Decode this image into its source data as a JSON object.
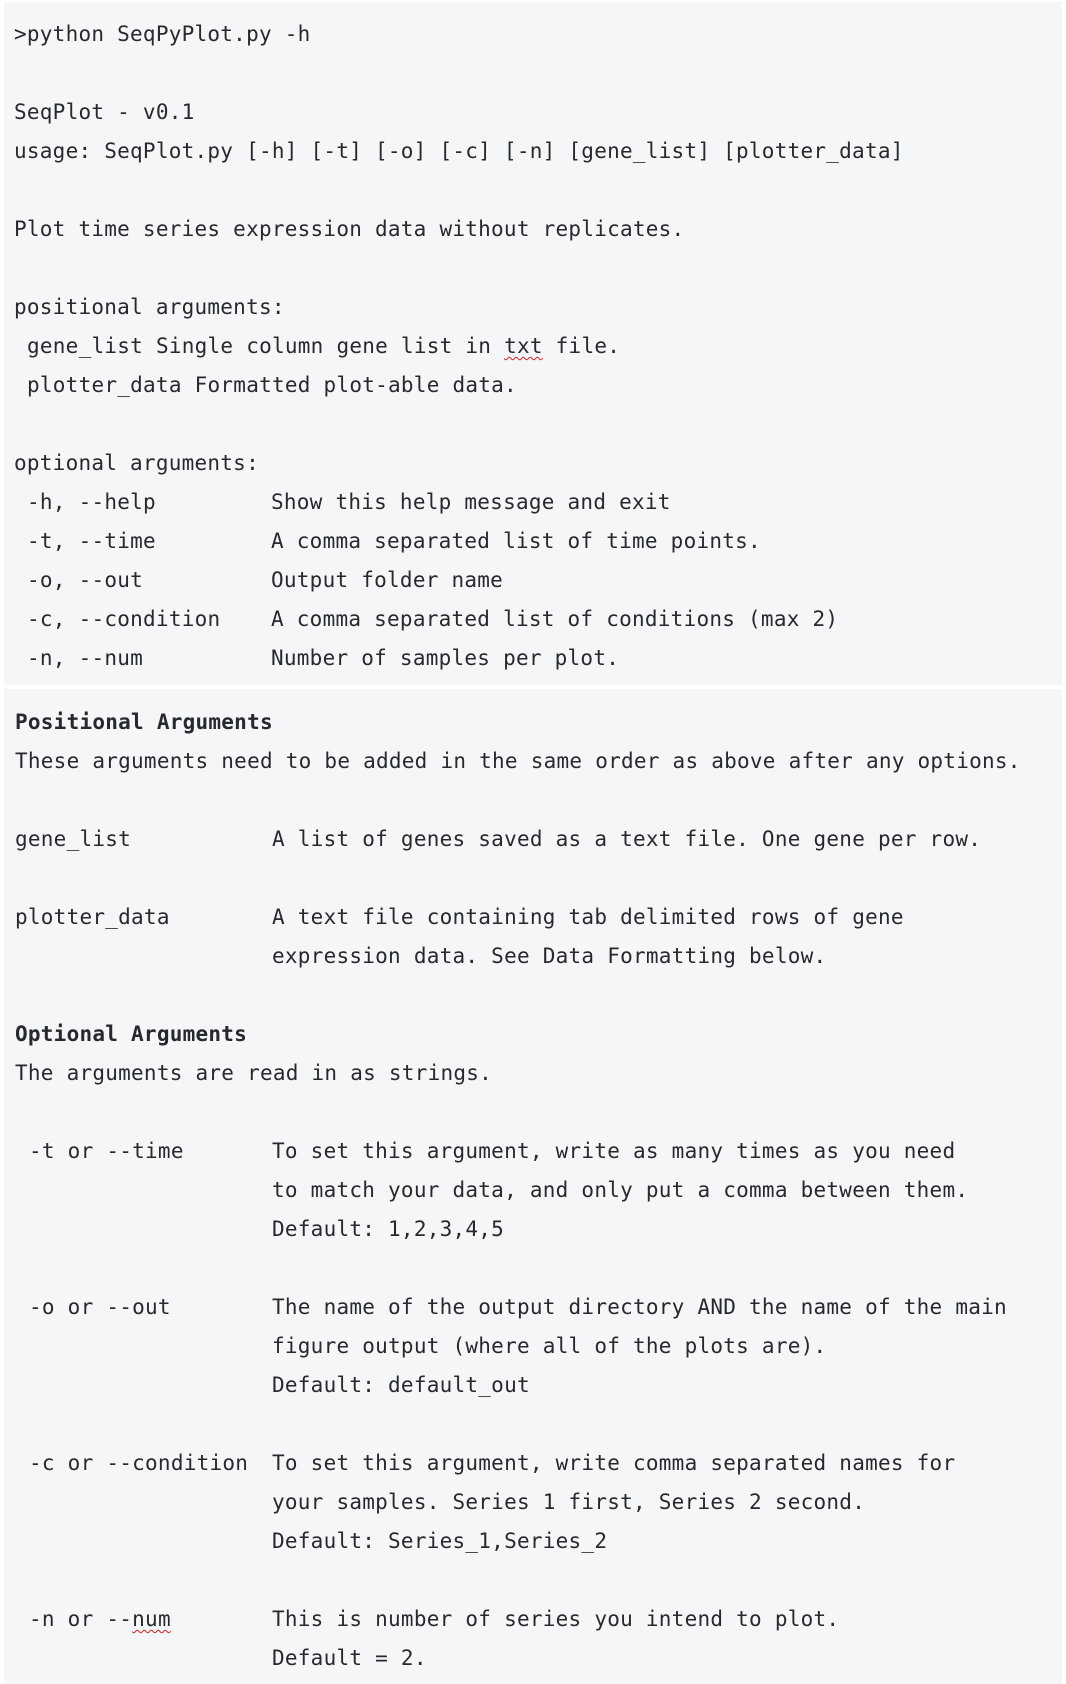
{
  "terminal": {
    "command": ">python SeqPyPlot.py -h",
    "version": "SeqPlot - v0.1",
    "usage": "usage: SeqPlot.py [-h] [-t] [-o] [-c] [-n] [gene_list] [plotter_data]",
    "description": "Plot time series expression data without replicates.",
    "positional_header": "positional arguments:",
    "positional": [
      {
        "name": "gene_list",
        "desc_before": "Single column gene list in ",
        "desc_underlined": "txt",
        "desc_after": " file."
      },
      {
        "name": "plotter_data",
        "desc": "Formatted plot-able data."
      }
    ],
    "optional_header": "optional arguments:",
    "optional": [
      {
        "flag": "-h, --help",
        "desc": "Show this help message and exit"
      },
      {
        "flag": "-t, --time",
        "desc": "A comma separated list of time points."
      },
      {
        "flag": "-o, --out",
        "desc": "Output folder name"
      },
      {
        "flag": "-c, --condition",
        "desc": "A comma separated list of conditions (max 2)"
      },
      {
        "flag": "-n, --num",
        "desc": "Number of samples per plot."
      }
    ]
  },
  "docs": {
    "positional_title": "Positional Arguments",
    "positional_intro": "These arguments need to be added in the same order as above after any options.",
    "positional_items": [
      {
        "name": "gene_list",
        "lines": [
          "A list of genes saved as a text file. One gene per row."
        ]
      },
      {
        "name": "plotter_data",
        "lines": [
          "A text file containing tab delimited rows of gene",
          "expression data. See Data Formatting below."
        ]
      }
    ],
    "optional_title": "Optional Arguments",
    "optional_intro": "The arguments are read in as strings.",
    "optional_items": [
      {
        "flag": "-t or --time",
        "lines": [
          "To set this argument, write as many times as you need",
          "to match your data, and only put a comma between them.",
          "Default: 1,2,3,4,5"
        ]
      },
      {
        "flag": "-o or --out",
        "lines": [
          "The name of the output directory AND the name of the main",
          "figure output (where all of the plots are).",
          "Default: default_out"
        ]
      },
      {
        "flag": "-c or --condition",
        "lines": [
          "To set this argument, write comma separated names for",
          "your samples. Series 1 first, Series 2 second.",
          "Default: Series_1,Series_2"
        ]
      },
      {
        "flag_before": "-n or --",
        "flag_underlined": "num",
        "lines": [
          "This is number of series you intend to plot.",
          "Default = 2."
        ]
      }
    ]
  }
}
